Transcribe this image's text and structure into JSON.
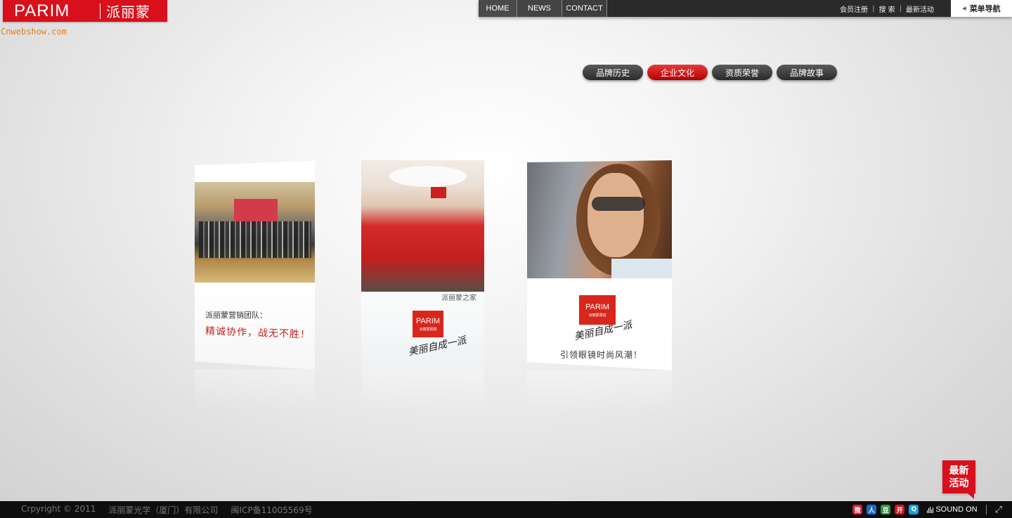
{
  "logo": {
    "en": "PARIM",
    "cn": "派丽蒙"
  },
  "watermark": "Cnwebshow.com",
  "topnav": {
    "links": [
      "HOME",
      "NEWS",
      "CONTACT"
    ],
    "util": [
      "会员注册",
      "搜 索",
      "最新活动"
    ],
    "separator": "|",
    "menu_label": "菜单导航"
  },
  "tabs": [
    {
      "label": "品牌历史",
      "active": false
    },
    {
      "label": "企业文化",
      "active": true
    },
    {
      "label": "资质荣誉",
      "active": false
    },
    {
      "label": "品牌故事",
      "active": false
    }
  ],
  "cards": {
    "team": {
      "heading": "派丽蒙营销团队：",
      "slogan": "精诚协作，战无不胜！"
    },
    "home": {
      "caption": "派丽蒙之家",
      "brand": "PARIM",
      "brand_sub": "派丽蒙视镜",
      "signature": "美丽自成一派"
    },
    "fashion": {
      "brand": "PARIM",
      "brand_sub": "派丽蒙视镜",
      "signature": "美丽自成一派",
      "slogan": "引领眼镜时尚风潮！"
    }
  },
  "latest_badge": "最新活动",
  "footer": {
    "copyright": "Crpyright © 2011",
    "company": "派丽蒙光学（厦门）有限公司",
    "icp": "闽ICP备11005569号",
    "social_icons": [
      "weibo-icon",
      "renren-icon",
      "douban-icon",
      "kaixin-icon",
      "qzone-icon"
    ],
    "sound": "SOUND ON",
    "colors": {
      "weibo": "#e6162d",
      "renren": "#1a6bd1",
      "douban": "#2e963d",
      "kaixin": "#d8101c",
      "qzone": "#1aa1d6"
    }
  },
  "colors": {
    "brand_red": "#d8101c",
    "nav_dark": "#2a2a2a"
  }
}
